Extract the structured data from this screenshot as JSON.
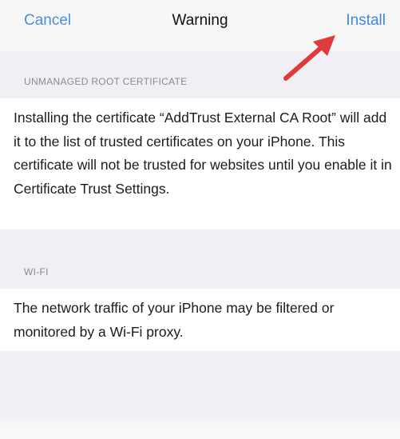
{
  "nav": {
    "cancel_label": "Cancel",
    "title": "Warning",
    "install_label": "Install"
  },
  "sections": {
    "certificate": {
      "header": "UNMANAGED ROOT CERTIFICATE",
      "body": "Installing the certificate “AddTrust External CA Root” will add it to the list of trusted certificates on your iPhone. This certificate will not be trusted for websites until you enable it in Certificate Trust Settings."
    },
    "wifi": {
      "header": "WI-FI",
      "body": "The network traffic of your iPhone may be filtered or monitored by a Wi-Fi proxy."
    }
  },
  "colors": {
    "accent": "#3f88da",
    "annotation_arrow": "#e03a3a",
    "background": "#efeff4"
  },
  "icons": {
    "annotation": "arrow-pointer-icon"
  }
}
